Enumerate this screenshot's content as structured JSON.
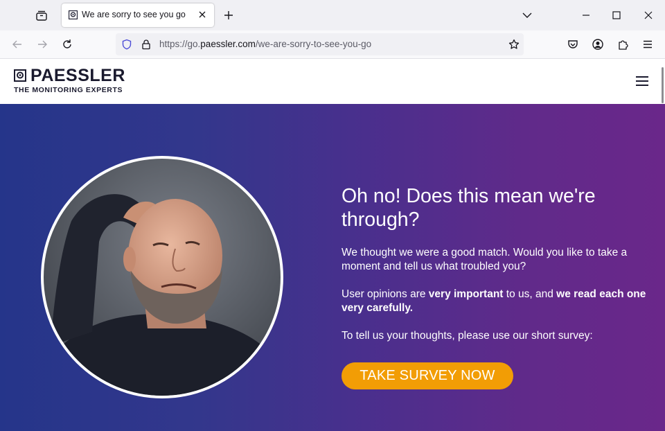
{
  "browser": {
    "tab": {
      "title": "We are sorry to see you go"
    },
    "url": {
      "prefix": "https://go.",
      "host": "paessler.com",
      "path": "/we-are-sorry-to-see-you-go"
    }
  },
  "site": {
    "brand": "PAESSLER",
    "tagline": "THE MONITORING EXPERTS"
  },
  "hero": {
    "heading": "Oh no! Does this mean we're through?",
    "para1": "We thought we were a good match. Would you like to take a moment and tell us what troubled you?",
    "para2": {
      "t1": "User opinions are ",
      "b1": "very important",
      "t2": " to us, and ",
      "b2": "we read each one very carefully."
    },
    "para3": "To tell us your thoughts, please use our short survey:",
    "cta": "TAKE SURVEY NOW"
  },
  "colors": {
    "cta": "#f29d05",
    "gradient_start": "#25358a",
    "gradient_end": "#6a278a"
  }
}
